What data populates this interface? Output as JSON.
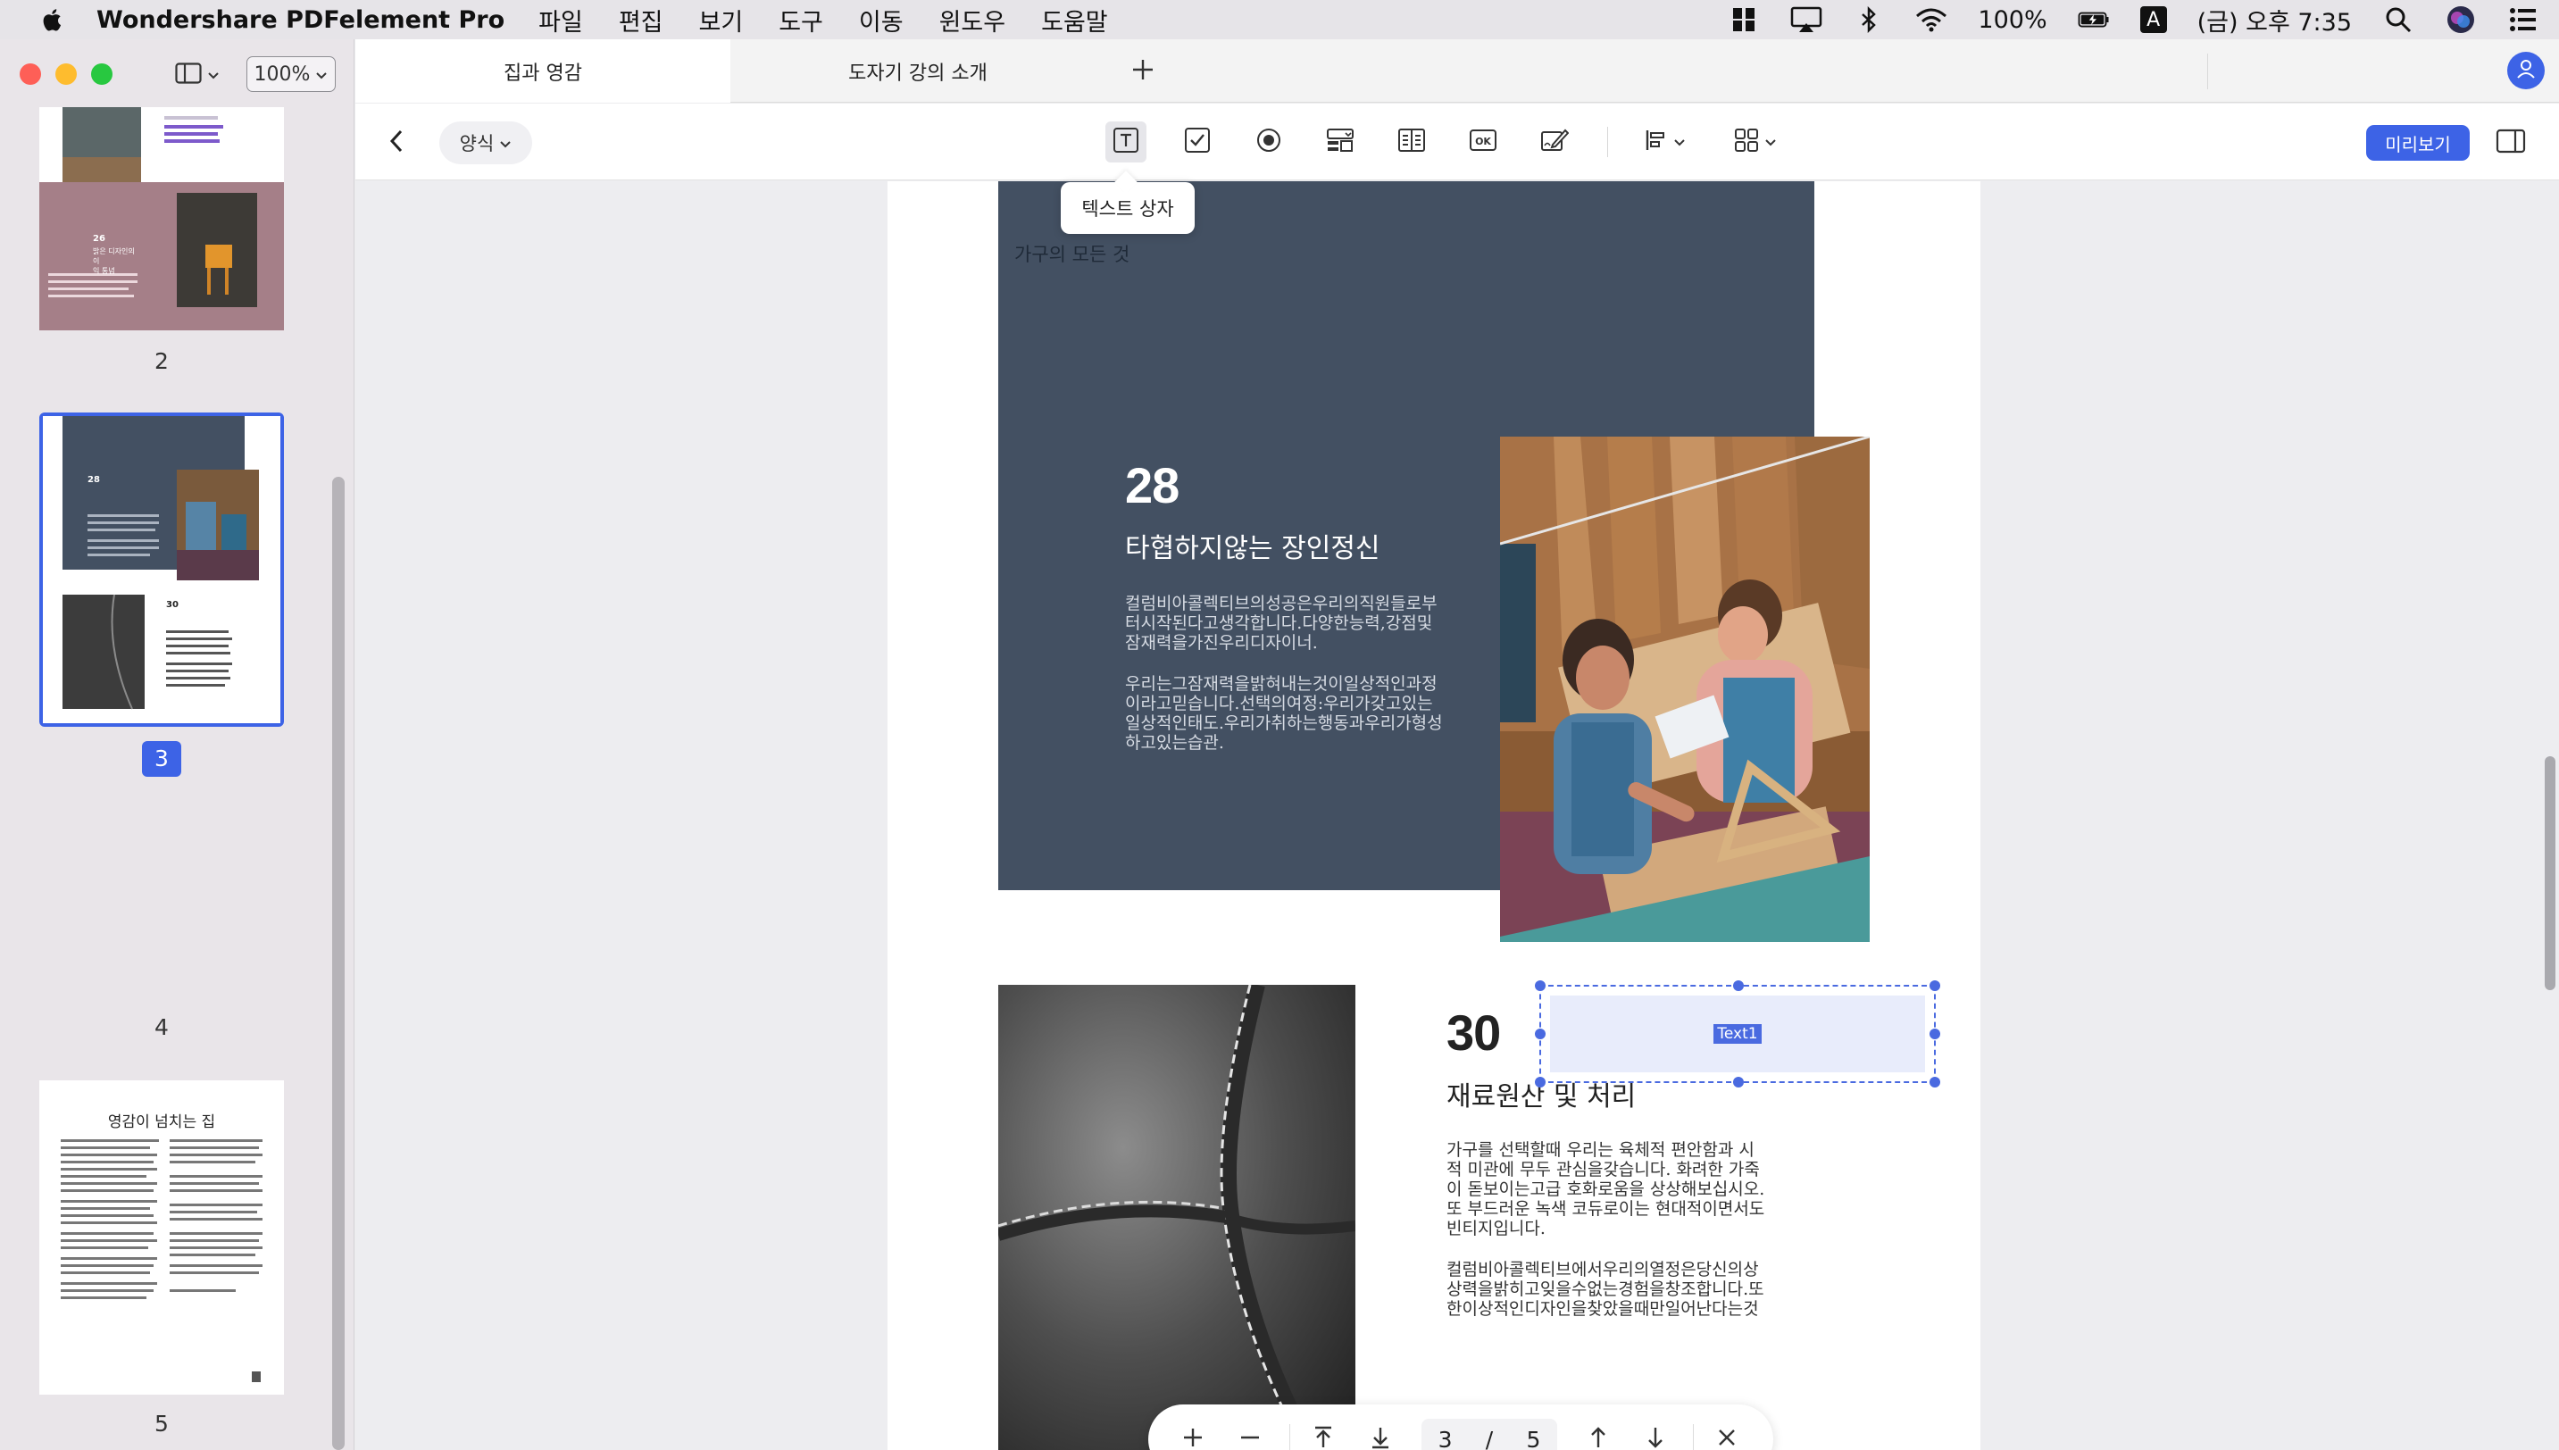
{
  "menubar": {
    "app_name": "Wondershare PDFelement Pro",
    "menus": [
      "파일",
      "편집",
      "보기",
      "도구",
      "이동",
      "윈도우",
      "도움말"
    ],
    "battery": "100%",
    "input_source": "A",
    "clock": "(금) 오후 7:35"
  },
  "sidebar": {
    "zoom": "100%",
    "thumbnails": [
      {
        "page": "2",
        "num26": "26",
        "thumb26_title": "밝은 디자인의 이\n익 통념"
      },
      {
        "page": "3",
        "num28": "28",
        "num30": "30",
        "selected": true
      },
      {
        "page": "4"
      },
      {
        "page": "5",
        "title": "영감이 넘치는 집"
      }
    ]
  },
  "tabs": {
    "items": [
      "집과 영감",
      "도자기 강의 소개"
    ],
    "active_index": 0
  },
  "toolbar": {
    "form_label": "양식",
    "tooltip": "텍스트 상자",
    "preview_label": "미리보기"
  },
  "page": {
    "running_head": "가구의 모든 것",
    "section1": {
      "number": "28",
      "title": "타협하지않는 장인정신",
      "para1": "컬럼비아콜렉티브의성공은우리의직원들로부터시작된다고생각합니다.다양한능력,강점및잠재력을가진우리디자이너.",
      "para2": "우리는그잠재력을밝혀내는것이일상적인과정이라고믿습니다.선택의여정:우리가갖고있는일상적인태도.우리가취하는행동과우리가형성하고있는습관."
    },
    "section2": {
      "number": "30",
      "title": "재료원산 및 처리",
      "para1": "가구를 선택할때 우리는 육체적 편안함과 시적 미관에 무두 관심을갖습니다. 화려한 가죽이 돋보이는고급 호화로움을 상상해보십시오.또 부드러운 녹색 코듀로이는 현대적이면서도 빈티지입니다.",
      "para2": "컬럼비아콜렉티브에서우리의열정은당신의상상력을밝히고잊을수없는경험을창조합니다.또한이상적인디자인을찾았을때만일어난다는것"
    },
    "form_field": {
      "label": "Text1"
    }
  },
  "pager": {
    "current": "3",
    "separator": "/",
    "total": "5"
  },
  "colors": {
    "accent": "#3d63e6",
    "dark_block": "#435062"
  }
}
